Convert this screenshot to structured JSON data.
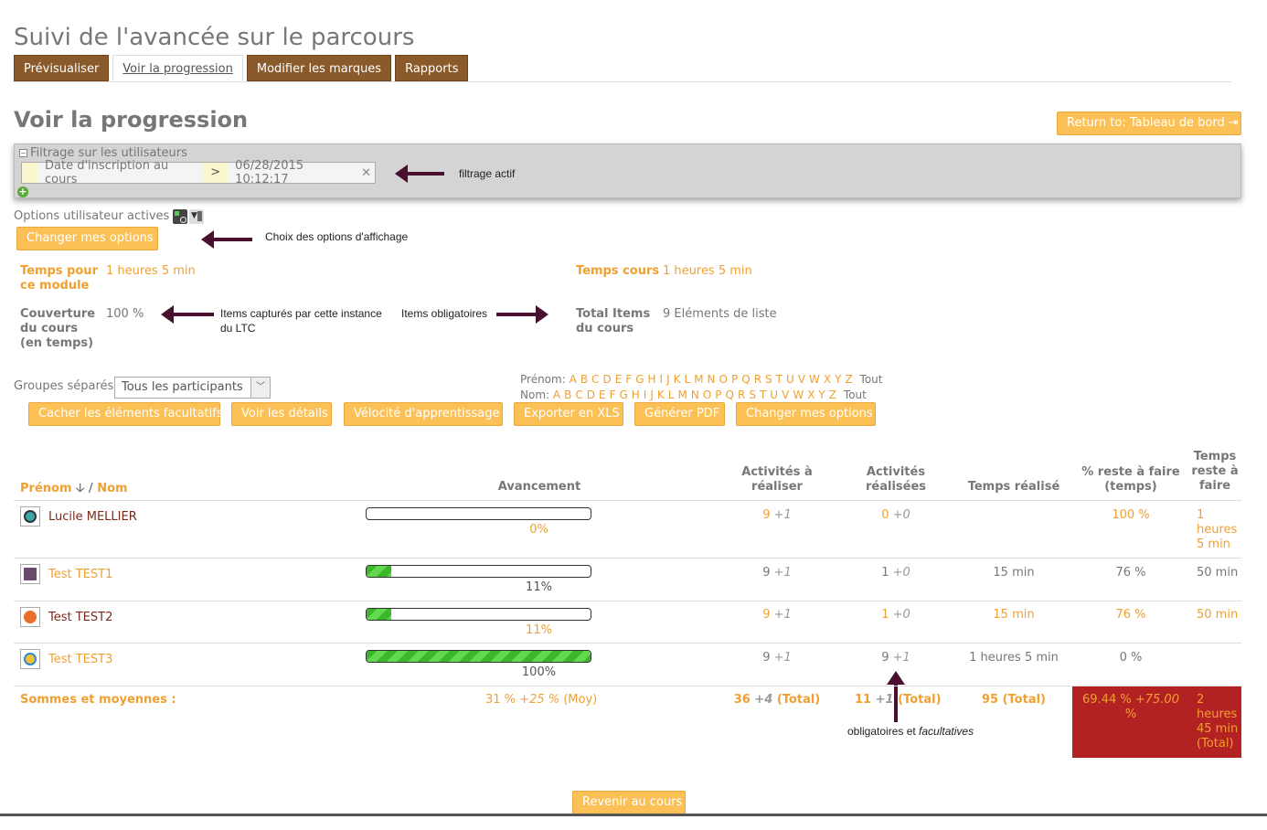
{
  "page_title": "Suivi de l'avancée sur le parcours",
  "tabs": [
    {
      "label": "Prévisualiser"
    },
    {
      "label": "Voir la progression"
    },
    {
      "label": "Modifier les marques"
    },
    {
      "label": "Rapports"
    }
  ],
  "section_title": "Voir la progression",
  "return_button": "Return to: Tableau de bord",
  "filter": {
    "title": "Filtrage sur les utilisateurs",
    "field": "Date d'inscription au cours",
    "operator": ">",
    "value": "06/28/2015 10:12:17"
  },
  "user_options_label": "Options utilisateur actives :",
  "change_options_button": "Changer mes options",
  "annotations": {
    "active_filter": "filtrage actif",
    "display_options": "Choix des options d'affichage",
    "captured_items": "Items capturés par cette instance du LTC",
    "mandatory_items": "Items obligatoires",
    "mandatory_optional_pre": "obligatoires et ",
    "mandatory_optional_em": "facultatives"
  },
  "info": {
    "module_time_label": "Temps pour ce module",
    "module_time_value": "1 heures 5 min",
    "course_time_label": "Temps cours",
    "course_time_value": "1 heures 5 min",
    "coverage_label": "Couverture du cours (en temps)",
    "coverage_value": "100 %",
    "total_items_label": "Total Items du cours",
    "total_items_value": "9 Eléments de liste"
  },
  "groups_label": "Groupes séparés",
  "groups_selected": "Tous les participants",
  "alpha_filter": {
    "firstname_label": "Prénom:",
    "lastname_label": "Nom:",
    "letters": [
      "A",
      "B",
      "C",
      "D",
      "E",
      "F",
      "G",
      "H",
      "I",
      "J",
      "K",
      "L",
      "M",
      "N",
      "O",
      "P",
      "Q",
      "R",
      "S",
      "T",
      "U",
      "V",
      "W",
      "X",
      "Y",
      "Z"
    ],
    "all_label": "Tout"
  },
  "action_buttons": [
    "Cacher les éléments facultatifs",
    "Voir les détails",
    "Vélocité d'apprentissage",
    "Exporter en XLS",
    "Générer PDF",
    "Changer mes options"
  ],
  "table": {
    "headers": {
      "firstname": "Prénom",
      "sort_arrow": "🡣",
      "separator": "/",
      "lastname": "Nom",
      "progress": "Avancement",
      "todo": "Activités à réaliser",
      "done": "Activités réalisées",
      "time_spent": "Temps réalisé",
      "remaining_pct": "% reste à faire (temps)",
      "remaining_time": "Temps reste à faire"
    },
    "rows": [
      {
        "name": "Lucile MELLIER",
        "progress": 0,
        "progress_label": "0%",
        "todo": "9",
        "todo_opt": "+1",
        "done": "0",
        "done_opt": "+0",
        "time_spent": "",
        "remaining_pct": "100 %",
        "remaining_time": "1 heures 5 min"
      },
      {
        "name": "Test TEST1",
        "progress": 11,
        "progress_label": "11%",
        "todo": "9",
        "todo_opt": "+1",
        "done": "1",
        "done_opt": "+0",
        "time_spent": "15 min",
        "remaining_pct": "76 %",
        "remaining_time": "50 min"
      },
      {
        "name": "Test TEST2",
        "progress": 11,
        "progress_label": "11%",
        "todo": "9",
        "todo_opt": "+1",
        "done": "1",
        "done_opt": "+0",
        "time_spent": "15 min",
        "remaining_pct": "76 %",
        "remaining_time": "50 min"
      },
      {
        "name": "Test TEST3",
        "progress": 100,
        "progress_label": "100%",
        "todo": "9",
        "todo_opt": "+1",
        "done": "9",
        "done_opt": "+1",
        "time_spent": "1 heures 5 min",
        "remaining_pct": "0 %",
        "remaining_time": ""
      }
    ],
    "totals": {
      "label": "Sommes et moyennes :",
      "progress": "31 %",
      "progress_opt": "+25 %",
      "progress_suffix": "(Moy)",
      "todo": "36",
      "todo_opt": "+4",
      "todo_suffix": "(Total)",
      "done": "11",
      "done_opt": "+1",
      "done_suffix": "(Total)",
      "time_spent": "95 (Total)",
      "remaining_pct": "69.44 %",
      "remaining_pct_opt": "+75.00",
      "remaining_pct_unit": "%",
      "remaining_time": "2 heures 45 min (Total)"
    }
  },
  "back_button": "Revenir au cours"
}
